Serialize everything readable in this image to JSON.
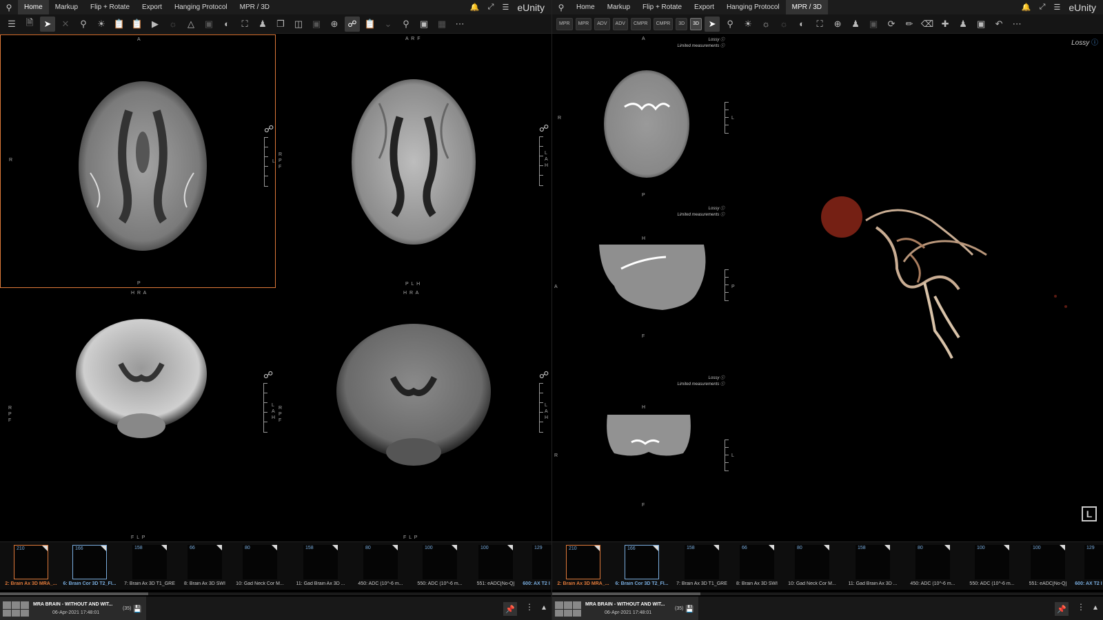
{
  "app": {
    "brand": "eUnity",
    "menu_tabs": [
      "Home",
      "Markup",
      "Flip + Rotate",
      "Export",
      "Hanging Protocol",
      "MPR / 3D"
    ]
  },
  "left_pane": {
    "active_tab": "Home",
    "viewports": [
      {
        "top": "A",
        "bottom": "P",
        "left": "R",
        "right": "",
        "ruler_label": "L",
        "ruler_label2": "R P F"
      },
      {
        "top": "A R F",
        "bottom": "P L H",
        "left": "",
        "right": "",
        "ruler_label": "L A H"
      },
      {
        "top": "H R A",
        "bottom": "F L P",
        "left": "R P F",
        "right": "",
        "ruler_label": "L A H",
        "ruler_label2": "R P F"
      },
      {
        "top": "H R A",
        "bottom": "F L P",
        "left": "",
        "right": "",
        "ruler_label": "L A H"
      }
    ]
  },
  "right_pane": {
    "active_tab": "MPR / 3D",
    "mode_buttons": [
      "MPR",
      "MPR",
      "ADV",
      "ADV",
      "CMPR",
      "CMPR",
      "3D",
      "3D"
    ],
    "lossy_label": "Lossy",
    "limited_label": "Limited measurements",
    "big_lossy": "Lossy",
    "orientation_marker": "L",
    "mpr_views": [
      {
        "top": "A",
        "bottom": "P",
        "left": "R",
        "ruler": "L"
      },
      {
        "top": "H",
        "bottom": "F",
        "left": "A",
        "ruler": "P"
      },
      {
        "top": "H",
        "bottom": "F",
        "left": "R",
        "ruler": "L"
      }
    ]
  },
  "thumbnails": [
    {
      "count": "210",
      "label": "2: Brain Ax 3D MRA_..."
    },
    {
      "count": "166",
      "label": "6: Brain Cor 3D T2_Fl..."
    },
    {
      "count": "158",
      "label": "7: Brain Ax 3D T1_GRE"
    },
    {
      "count": "66",
      "label": "8: Brain Ax 3D SWI"
    },
    {
      "count": "80",
      "label": "10: Gad Neck Cor M..."
    },
    {
      "count": "158",
      "label": "11: Gad Brain Ax 3D ..."
    },
    {
      "count": "80",
      "label": "450: ADC (10^-6 m..."
    },
    {
      "count": "100",
      "label": "550: ADC (10^-6 m..."
    },
    {
      "count": "100",
      "label": "551: eADC[No-Q]"
    },
    {
      "count": "129",
      "label": "600: AX T2 I"
    }
  ],
  "study": {
    "title": "MRA BRAIN - WITHOUT AND WIT...",
    "date": "06-Apr-2021 17:48:01",
    "count": "(35)"
  }
}
